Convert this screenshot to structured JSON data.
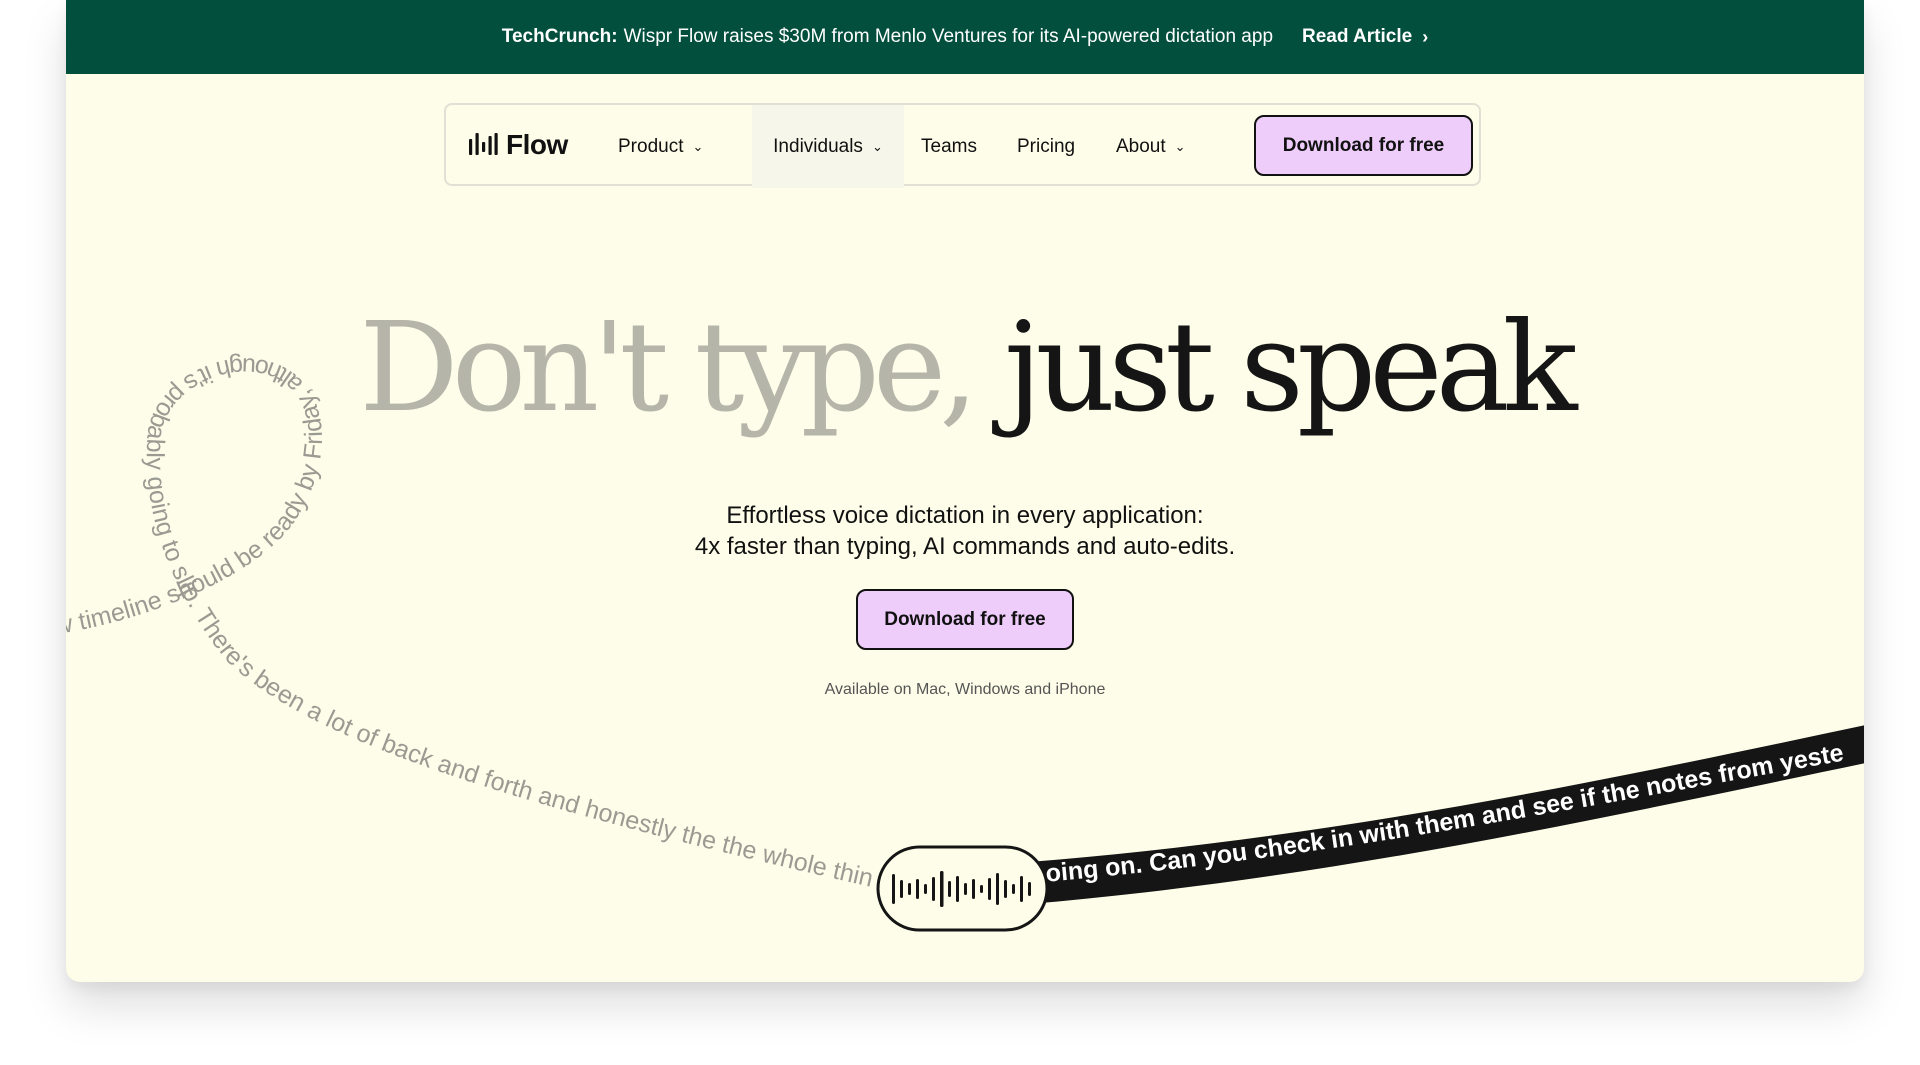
{
  "banner": {
    "source": "TechCrunch:",
    "headline": "Wispr Flow raises $30M from Menlo Ventures for its AI-powered dictation app",
    "link_label": "Read Article",
    "link_icon": "chevron-right-icon",
    "background": "#034f3e"
  },
  "nav": {
    "logo_text": "Flow",
    "logo_icon": "waveform-bars-icon",
    "items": [
      {
        "label": "Product",
        "dropdown": true
      },
      {
        "label": "Individuals",
        "dropdown": true,
        "active": true
      },
      {
        "label": "Teams",
        "dropdown": false
      },
      {
        "label": "Pricing",
        "dropdown": false
      },
      {
        "label": "About",
        "dropdown": true
      }
    ],
    "cta_label": "Download for free"
  },
  "hero": {
    "title_light": "Don't type,",
    "title_dark": "just speak",
    "subtitle_line1": "Effortless voice dictation in every application:",
    "subtitle_line2": "4x faster than typing, AI commands and auto-edits.",
    "cta_label": "Download for free",
    "availability": "Available on Mac, Windows and iPhone"
  },
  "ribbon": {
    "spoken_text": "w timeline should be ready by Friday, although it's probably going to slip. There's been a lot of back and forth and honestly the the whole thin",
    "transcribed_text": "going on. Can you check in with them and see if the notes from yeste",
    "mic_icon": "voice-waveform-icon"
  },
  "colors": {
    "page_background": "#fdfde9",
    "accent_button": "#eecdfb",
    "title_light": "#b5b5aa",
    "title_dark": "#151515",
    "ribbon": "#151515"
  }
}
